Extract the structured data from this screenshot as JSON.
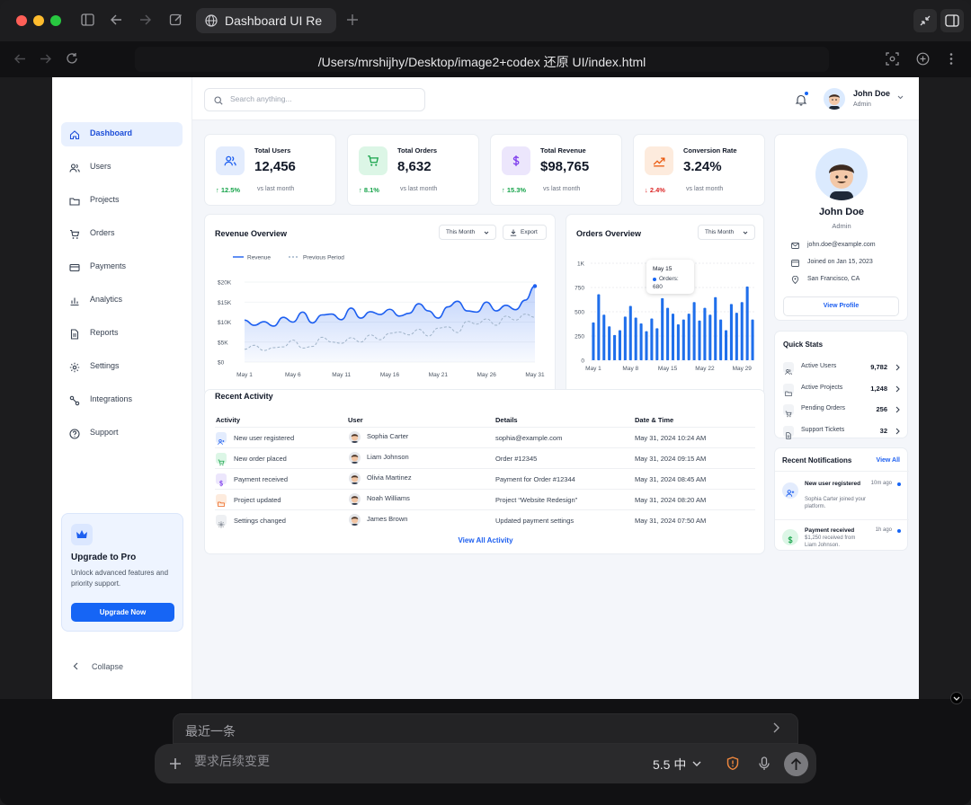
{
  "browser": {
    "tab_title": "Dashboard UI Re",
    "url": "/Users/mrshijhy/Desktop/image2+codex 还原 UI/index.html"
  },
  "sidebar": {
    "items": [
      {
        "label": "Dashboard",
        "icon": "home-icon",
        "active": true
      },
      {
        "label": "Users",
        "icon": "users-icon"
      },
      {
        "label": "Projects",
        "icon": "folder-icon"
      },
      {
        "label": "Orders",
        "icon": "cart-icon"
      },
      {
        "label": "Payments",
        "icon": "card-icon"
      },
      {
        "label": "Analytics",
        "icon": "bar-chart-icon"
      },
      {
        "label": "Reports",
        "icon": "document-icon"
      },
      {
        "label": "Settings",
        "icon": "gear-icon"
      },
      {
        "label": "Integrations",
        "icon": "integration-icon"
      },
      {
        "label": "Support",
        "icon": "help-icon"
      }
    ],
    "upgrade": {
      "title": "Upgrade to Pro",
      "description": "Unlock advanced features and priority support.",
      "button": "Upgrade Now"
    },
    "collapse_label": "Collapse"
  },
  "topbar": {
    "search_placeholder": "Search anything...",
    "user_name": "John Doe",
    "user_role": "Admin"
  },
  "stats": [
    {
      "title": "Total Users",
      "value": "12,456",
      "change": "↑ 12.5%",
      "direction": "up",
      "vs": "vs last month",
      "icon": "users-icon",
      "tint": "#e3ecfd",
      "color": "#1d5ff0"
    },
    {
      "title": "Total Orders",
      "value": "8,632",
      "change": "↑ 8.1%",
      "direction": "up",
      "vs": "vs last month",
      "icon": "cart-icon",
      "tint": "#dcf6e6",
      "color": "#16a34a"
    },
    {
      "title": "Total Revenue",
      "value": "$98,765",
      "change": "↑ 15.3%",
      "direction": "up",
      "vs": "vs last month",
      "icon": "dollar-icon",
      "tint": "#ece6fc",
      "color": "#7c3aed"
    },
    {
      "title": "Conversion Rate",
      "value": "3.24%",
      "change": "↓ 2.4%",
      "direction": "down",
      "vs": "vs last month",
      "icon": "trend-icon",
      "tint": "#fdebdd",
      "color": "#ea580c"
    }
  ],
  "colors": {
    "accent": "#1665f5",
    "up": "#16a34a",
    "down": "#dc2626"
  },
  "revenue_card": {
    "title": "Revenue Overview",
    "period": "This Month",
    "export": "Export"
  },
  "orders_card": {
    "title": "Orders Overview",
    "period": "This Month",
    "tooltip": {
      "date": "May 15",
      "label": "Orders:",
      "value": "680"
    }
  },
  "chart_data": [
    {
      "type": "area",
      "title": "Revenue Overview",
      "x": [
        "May 1",
        "May 6",
        "May 11",
        "May 16",
        "May 21",
        "May 26",
        "May 31"
      ],
      "yticks": [
        "$20K",
        "$15K",
        "$10K",
        "$5K",
        "$0"
      ],
      "ylim": [
        0,
        20000
      ],
      "legend_placement": "top-left",
      "grid": true,
      "series": [
        {
          "name": "Revenue",
          "style": "solid",
          "color": "#1d5ff0",
          "values": [
            10500,
            9200,
            10100,
            9000,
            11200,
            10000,
            12500,
            9800,
            11800,
            12000,
            10600,
            13500,
            11000,
            12600,
            11900,
            13200,
            11500,
            12200,
            14600,
            12800,
            11000,
            13800,
            15200,
            12800,
            12500,
            15000,
            12800,
            14200,
            13100,
            15500,
            19000
          ]
        },
        {
          "name": "Previous Period",
          "style": "dashed",
          "color": "#9fb3c8",
          "values": [
            3200,
            4200,
            2900,
            3600,
            3800,
            5500,
            3500,
            3900,
            6200,
            5000,
            4700,
            6100,
            5000,
            6800,
            5600,
            7200,
            7500,
            6800,
            8200,
            6500,
            8500,
            8800,
            7400,
            10200,
            9500,
            10800,
            9200,
            11500,
            10500,
            12000,
            11200
          ]
        }
      ]
    },
    {
      "type": "bar",
      "title": "Orders Overview",
      "x": [
        "May 1",
        "May 8",
        "May 15",
        "May 22",
        "May 29"
      ],
      "yticks": [
        "1K",
        "750",
        "500",
        "250",
        "0"
      ],
      "ylim": [
        0,
        1000
      ],
      "grid": true,
      "series": [
        {
          "name": "Orders",
          "color": "#1f6feb",
          "values": [
            390,
            680,
            470,
            350,
            260,
            310,
            450,
            560,
            440,
            380,
            300,
            430,
            330,
            640,
            540,
            480,
            370,
            420,
            480,
            600,
            410,
            540,
            470,
            650,
            420,
            310,
            580,
            490,
            600,
            760,
            420
          ]
        }
      ]
    }
  ],
  "activity": {
    "title": "Recent Activity",
    "headers": [
      "Activity",
      "User",
      "Details",
      "Date & Time"
    ],
    "rows": [
      {
        "activity": "New user registered",
        "icon": "user-add-icon",
        "tint": "#e3ecfd",
        "color": "#1d5ff0",
        "user": "Sophia Carter",
        "details": "sophia@example.com",
        "time": "May 31, 2024 10:24 AM"
      },
      {
        "activity": "New order placed",
        "icon": "cart-icon",
        "tint": "#dcf6e6",
        "color": "#16a34a",
        "user": "Liam Johnson",
        "details": "Order #12345",
        "time": "May 31, 2024 09:15 AM"
      },
      {
        "activity": "Payment received",
        "icon": "dollar-icon",
        "tint": "#ece6fc",
        "color": "#7c3aed",
        "user": "Olivia Martinez",
        "details": "Payment for Order #12344",
        "time": "May 31, 2024 08:45 AM"
      },
      {
        "activity": "Project updated",
        "icon": "folder-icon",
        "tint": "#fdebdd",
        "color": "#ea580c",
        "user": "Noah Williams",
        "details": "Project “Website Redesign”",
        "time": "May 31, 2024 08:20 AM"
      },
      {
        "activity": "Settings changed",
        "icon": "gear-icon",
        "tint": "#eef0f3",
        "color": "#4b5563",
        "user": "James Brown",
        "details": "Updated payment settings",
        "time": "May 31, 2024 07:50 AM"
      }
    ],
    "view_all": "View All Activity"
  },
  "profile": {
    "name": "John Doe",
    "role": "Admin",
    "email": "john.doe@example.com",
    "joined": "Joined on Jan 15, 2023",
    "location": "San Francisco, CA",
    "button": "View Profile"
  },
  "quick_stats": {
    "title": "Quick Stats",
    "items": [
      {
        "label": "Active Users",
        "value": "9,782"
      },
      {
        "label": "Active Projects",
        "value": "1,248"
      },
      {
        "label": "Pending Orders",
        "value": "256"
      },
      {
        "label": "Support Tickets",
        "value": "32"
      }
    ]
  },
  "notifications": {
    "title": "Recent Notifications",
    "view_all": "View All",
    "items": [
      {
        "title": "New user registered",
        "body": "Sophia Carter joined your platform.",
        "time": "10m ago"
      },
      {
        "title": "Payment received",
        "body": "$1,250 received from Liam Johnson.",
        "time": "1h ago"
      }
    ]
  },
  "composer": {
    "recent_label": "最近一条",
    "placeholder": "要求后续变更",
    "model": "5.5 中"
  }
}
